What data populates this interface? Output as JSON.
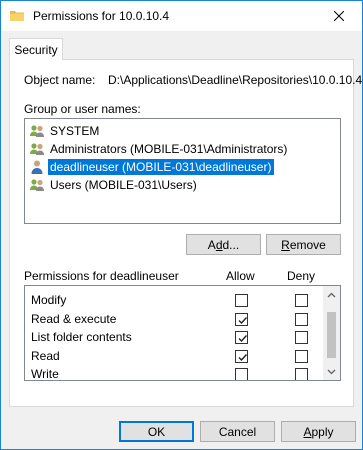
{
  "window": {
    "title": "Permissions for 10.0.10.4",
    "colors": {
      "accent": "#0078d7",
      "border": "#1883d7",
      "folder": "#f8d26a"
    }
  },
  "tabs": [
    {
      "label": "Security"
    }
  ],
  "object": {
    "label": "Object name:",
    "value": "D:\\Applications\\Deadline\\Repositories\\10.0.10.4"
  },
  "groups": {
    "label": "Group or user names:",
    "items": [
      {
        "label": "SYSTEM",
        "icon": "users-group-icon",
        "selected": false
      },
      {
        "label": "Administrators (MOBILE-031\\Administrators)",
        "icon": "users-group-icon",
        "selected": false
      },
      {
        "label": "deadlineuser (MOBILE-031\\deadlineuser)",
        "icon": "user-icon",
        "selected": true
      },
      {
        "label": "Users (MOBILE-031\\Users)",
        "icon": "users-group-icon",
        "selected": false
      }
    ]
  },
  "buttons": {
    "add_pre": "A",
    "add_key": "d",
    "add_post": "d...",
    "remove_key": "R",
    "remove_post": "emove",
    "ok": "OK",
    "cancel": "Cancel",
    "apply_key": "A",
    "apply_post": "pply"
  },
  "permissions": {
    "label": "Permissions for deadlineuser",
    "allow_header": "Allow",
    "deny_header": "Deny",
    "rows": [
      {
        "name": "Modify",
        "allow": false,
        "deny": false
      },
      {
        "name": "Read & execute",
        "allow": true,
        "deny": false
      },
      {
        "name": "List folder contents",
        "allow": true,
        "deny": false
      },
      {
        "name": "Read",
        "allow": true,
        "deny": false
      },
      {
        "name": "Write",
        "allow": false,
        "deny": false
      },
      {
        "name": "",
        "allow": false,
        "deny": false
      }
    ]
  }
}
